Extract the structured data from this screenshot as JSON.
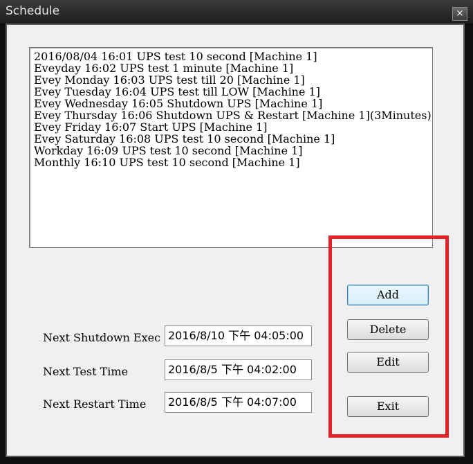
{
  "window": {
    "title": "Schedule",
    "close_glyph": "×"
  },
  "schedule_list": {
    "items": [
      "2016/08/04 16:01 UPS test 10 second [Machine 1]",
      "Eveyday 16:02 UPS test 1 minute [Machine 1]",
      "Evey Monday 16:03 UPS test till 20 [Machine 1]",
      "Evey Tuesday 16:04 UPS test till LOW [Machine 1]",
      "Evey Wednesday 16:05 Shutdown UPS [Machine 1]",
      "Evey Thursday 16:06 Shutdown UPS & Restart [Machine 1](3Minutes)",
      "Evey Friday 16:07 Start UPS [Machine 1]",
      "Evey Saturday 16:08 UPS test 10 second [Machine 1]",
      "Workday 16:09 UPS test 10 second [Machine 1]",
      "Monthly 16:10 UPS test 10 second [Machine 1]"
    ]
  },
  "fields": {
    "next_shutdown": {
      "label": "Next Shutdown Exec",
      "value": "2016/8/10 下午 04:05:00"
    },
    "next_test": {
      "label": "Next Test Time",
      "value": "2016/8/5 下午 04:02:00"
    },
    "next_restart": {
      "label": "Next Restart Time",
      "value": "2016/8/5 下午 04:07:00"
    }
  },
  "buttons": {
    "add": "Add",
    "delete": "Delete",
    "edit": "Edit",
    "exit": "Exit"
  },
  "colors": {
    "highlight": "#e3232a",
    "titlebar": "#2a2a2a"
  }
}
